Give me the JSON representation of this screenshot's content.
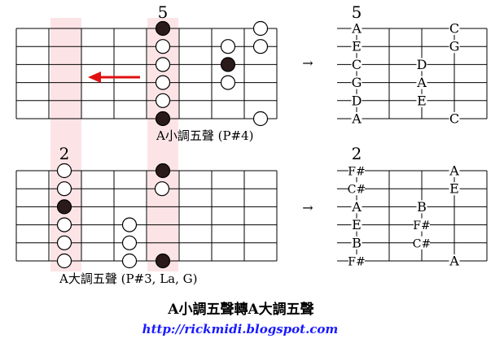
{
  "left_diagrams": [
    {
      "position_label": "5",
      "dark_marks": [
        [
          1,
          0
        ],
        [
          6,
          0
        ],
        [
          3,
          2
        ]
      ],
      "open_marks": [
        [
          2,
          0
        ],
        [
          3,
          0
        ],
        [
          4,
          0
        ],
        [
          5,
          0
        ],
        [
          2,
          2
        ],
        [
          4,
          2
        ],
        [
          1,
          3
        ],
        [
          6,
          3
        ],
        [
          1,
          3.5
        ]
      ],
      "caption": "A小調五聲 (P#4)"
    },
    {
      "position_label": "2",
      "dark_marks": [
        [
          3,
          0
        ],
        [
          1,
          3
        ],
        [
          6,
          3
        ]
      ],
      "open_marks": [
        [
          1,
          0
        ],
        [
          2,
          0
        ],
        [
          4,
          0
        ],
        [
          5,
          0
        ],
        [
          6,
          0
        ],
        [
          4,
          2
        ],
        [
          5,
          2
        ],
        [
          6,
          2
        ],
        [
          2,
          3
        ]
      ],
      "caption": "A大調五聲 (P#3, La, G)"
    }
  ],
  "right_diagrams": [
    {
      "position_label": "5",
      "notes": [
        {
          "string": 1,
          "fret": 0,
          "name": "A"
        },
        {
          "string": 2,
          "fret": 0,
          "name": "E"
        },
        {
          "string": 3,
          "fret": 0,
          "name": "C"
        },
        {
          "string": 4,
          "fret": 0,
          "name": "G"
        },
        {
          "string": 5,
          "fret": 0,
          "name": "D"
        },
        {
          "string": 6,
          "fret": 0,
          "name": "A"
        },
        {
          "string": 3,
          "fret": 2,
          "name": "D"
        },
        {
          "string": 4,
          "fret": 2,
          "name": "A"
        },
        {
          "string": 5,
          "fret": 2,
          "name": "E"
        },
        {
          "string": 1,
          "fret": 3,
          "name": "C"
        },
        {
          "string": 2,
          "fret": 3,
          "name": "G"
        },
        {
          "string": 6,
          "fret": 3,
          "name": "C"
        }
      ]
    },
    {
      "position_label": "2",
      "notes": [
        {
          "string": 1,
          "fret": 0,
          "name": "F#"
        },
        {
          "string": 2,
          "fret": 0,
          "name": "C#"
        },
        {
          "string": 3,
          "fret": 0,
          "name": "A"
        },
        {
          "string": 4,
          "fret": 0,
          "name": "E"
        },
        {
          "string": 5,
          "fret": 0,
          "name": "B"
        },
        {
          "string": 6,
          "fret": 0,
          "name": "F#"
        },
        {
          "string": 3,
          "fret": 2,
          "name": "B"
        },
        {
          "string": 4,
          "fret": 2,
          "name": "F#"
        },
        {
          "string": 5,
          "fret": 2,
          "name": "C#"
        },
        {
          "string": 1,
          "fret": 3,
          "name": "A"
        },
        {
          "string": 2,
          "fret": 3,
          "name": "E"
        },
        {
          "string": 6,
          "fret": 3,
          "name": "A"
        }
      ]
    }
  ],
  "arrow_symbol": "→",
  "title": "A小調五聲轉A大調五聲",
  "url": "http://rickmidi.blogspot.com",
  "colors": {
    "highlight": "#fce4e6",
    "arrow": "#e01010",
    "dark_dot": "#2a1a1a",
    "url": "#1a1aff"
  }
}
